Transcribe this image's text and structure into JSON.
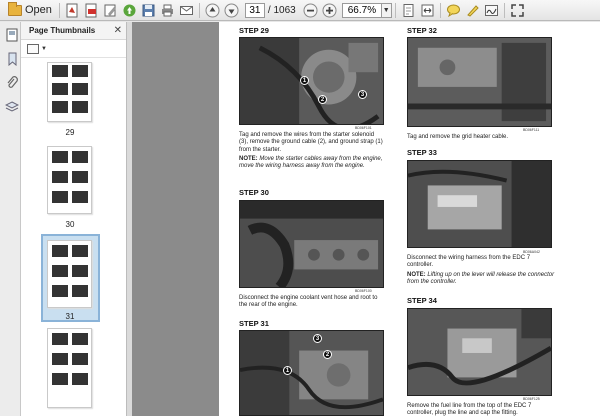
{
  "toolbar": {
    "open_label": "Open",
    "current_page": "31",
    "total_pages": "/ 1063",
    "zoom": "66.7%"
  },
  "thumbnails": {
    "title": "Page Thumbnails",
    "pages": [
      {
        "label": "29"
      },
      {
        "label": "30"
      },
      {
        "label": "31"
      }
    ]
  },
  "steps": [
    {
      "title": "STEP 29",
      "code": "BD06F101",
      "text": "Tag and remove the wires from the starter solenoid (3), remove the ground cable (2), and ground strap (1) from the starter.",
      "note_label": "NOTE:",
      "note": "Move the starter cables away from the engine, move the wiring harness away from the engine.",
      "callouts": [
        "1",
        "2",
        "3"
      ]
    },
    {
      "title": "STEP 30",
      "code": "BD06F100",
      "text": "Disconnect the engine coolant vent hose and root to the rear of the engine."
    },
    {
      "title": "STEP 31",
      "callouts": [
        "1",
        "2",
        "3"
      ]
    },
    {
      "title": "STEP 32",
      "code": "BD06F111",
      "text": "Tag and remove the grid heater cable."
    },
    {
      "title": "STEP 33",
      "code": "BD06A042",
      "text": "Disconnect the wiring harness from the EDC 7 controller.",
      "note_label": "NOTE:",
      "note": "Lifting up on the lever will release the connector from the controller."
    },
    {
      "title": "STEP 34",
      "code": "BD06F125",
      "text": "Remove the fuel line from the top of the EDC 7 controller, plug the line and cap the fitting."
    }
  ]
}
